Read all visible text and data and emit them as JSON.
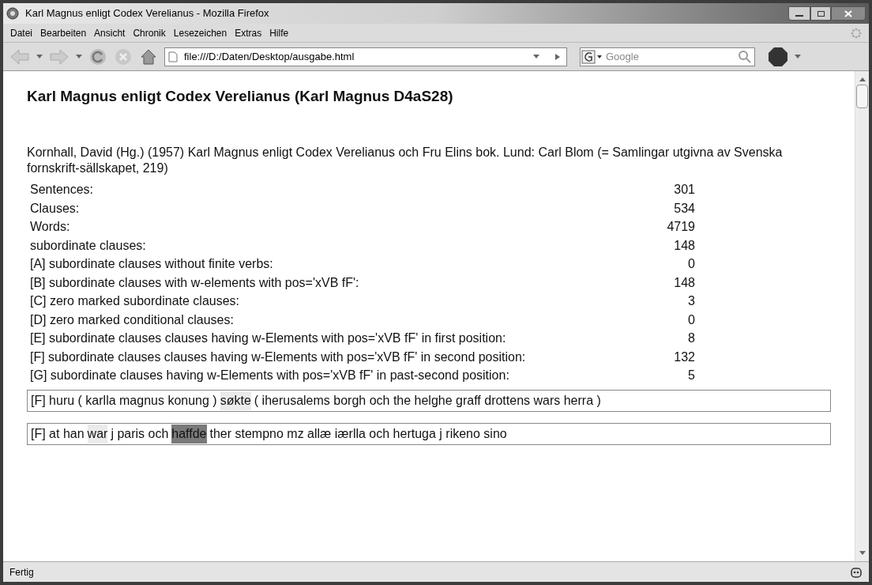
{
  "window": {
    "title": "Karl Magnus enligt Codex Verelianus - Mozilla Firefox"
  },
  "menu": [
    "Datei",
    "Bearbeiten",
    "Ansicht",
    "Chronik",
    "Lesezeichen",
    "Extras",
    "Hilfe"
  ],
  "address_bar": {
    "value": "file:///D:/Daten/Desktop/ausgabe.html"
  },
  "search": {
    "placeholder": "Google"
  },
  "page": {
    "heading": "Karl Magnus enligt Codex Verelianus (Karl Magnus D4aS28)",
    "citation": "Kornhall, David (Hg.) (1957) Karl Magnus enligt Codex Verelianus och Fru Elins bok. Lund: Carl Blom (= Samlingar utgivna av Svenska fornskrift-sällskapet, 219)",
    "stats": [
      {
        "label": "Sentences:",
        "value": "301"
      },
      {
        "label": "Clauses:",
        "value": "534"
      },
      {
        "label": "Words:",
        "value": "4719"
      },
      {
        "label": "subordinate clauses:",
        "value": "148"
      },
      {
        "label": "[A] subordinate clauses without finite verbs:",
        "value": "0"
      },
      {
        "label": "[B] subordinate clauses with w-elements with pos='xVB fF':",
        "value": "148"
      },
      {
        "label": "[C] zero marked subordinate clauses:",
        "value": "3"
      },
      {
        "label": "[D] zero marked conditional clauses:",
        "value": "0"
      },
      {
        "label": "[E] subordinate clauses clauses having w-Elements with pos='xVB fF' in first position:",
        "value": "8"
      },
      {
        "label": "[F] subordinate clauses clauses having w-Elements with pos='xVB fF' in second position:",
        "value": "132"
      },
      {
        "label": "[G] subordinate clauses having w-Elements with pos='xVB fF' in past-second position:",
        "value": "5"
      }
    ],
    "sentences": [
      {
        "segments": [
          {
            "text": "[F] huru ( karlla magnus konung )",
            "kind": "plain"
          },
          {
            "text": "søkte",
            "kind": "light"
          },
          {
            "text": "( iherusalems borgh och the helghe graff drottens wars herra )",
            "kind": "plain"
          }
        ]
      },
      {
        "segments": [
          {
            "text": "[F] at han",
            "kind": "plain"
          },
          {
            "text": "war",
            "kind": "light"
          },
          {
            "text": "j paris och",
            "kind": "plain"
          },
          {
            "text": "haffde",
            "kind": "dark"
          },
          {
            "text": "ther stempno mz allæ iærlla och hertuga j rikeno sino",
            "kind": "plain"
          }
        ]
      }
    ]
  },
  "status_bar": {
    "text": "Fertig"
  }
}
